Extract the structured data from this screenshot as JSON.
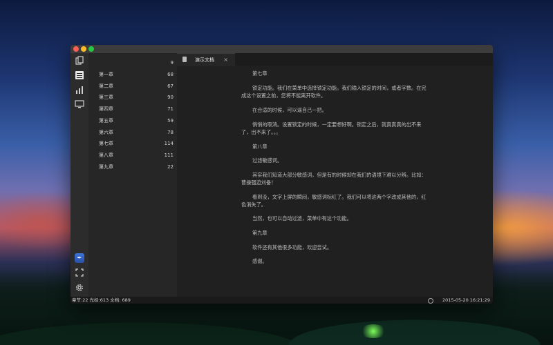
{
  "desktop": {},
  "sidebar_icons": [
    "documents-icon",
    "outline-icon",
    "chart-icon",
    "monitor-icon"
  ],
  "bottom_icons": [
    "app-tile-icon",
    "fullscreen-icon",
    "gear-icon"
  ],
  "chapters": {
    "header_count": "9",
    "items": [
      {
        "name": "第一章",
        "count": "68"
      },
      {
        "name": "第二章",
        "count": "67"
      },
      {
        "name": "第三章",
        "count": "90"
      },
      {
        "name": "第四章",
        "count": "71"
      },
      {
        "name": "第五章",
        "count": "59"
      },
      {
        "name": "第六章",
        "count": "78"
      },
      {
        "name": "第七章",
        "count": "114"
      },
      {
        "name": "第八章",
        "count": "111"
      },
      {
        "name": "第九章",
        "count": "22"
      }
    ]
  },
  "tab": {
    "label": "演示文档",
    "close": "×"
  },
  "document": {
    "paragraphs": [
      "第七章",
      "锁定功能。我们在菜单中选择锁定功能。我们输入锁定的时间，或者字数。在完成这个设置之前，您将不能离开软件。",
      "在合适的时候，可以逼自己一把。",
      "悄悄的取消。设置锁定的时候，一定要想好啊。锁定之后，就真真真的出不来了，出不来了。。。",
      "第八章",
      "过滤敏感词。",
      "其实我们知道大部分敏感词，但是有的时候却在我们的语境下难以分辨。比如：曹操强迫刘备！",
      "看到没，文字上屏的瞬间，敏感词标红了。我们可以将这两个字改成其他的，红色消失了。",
      "当然，也可以自动过滤，菜单中有这个功能。",
      "第九章",
      "软件还有其他很多功能，欢迎尝试。",
      "感谢。"
    ]
  },
  "status": {
    "left": "章节:22 光标:613 文档: 689",
    "right": "2015-05-20 16:21:29"
  },
  "colors": {
    "accent": "#3c74d6",
    "close": "#fc5f57",
    "minimize": "#fdbc2e",
    "maximize": "#28c840"
  }
}
